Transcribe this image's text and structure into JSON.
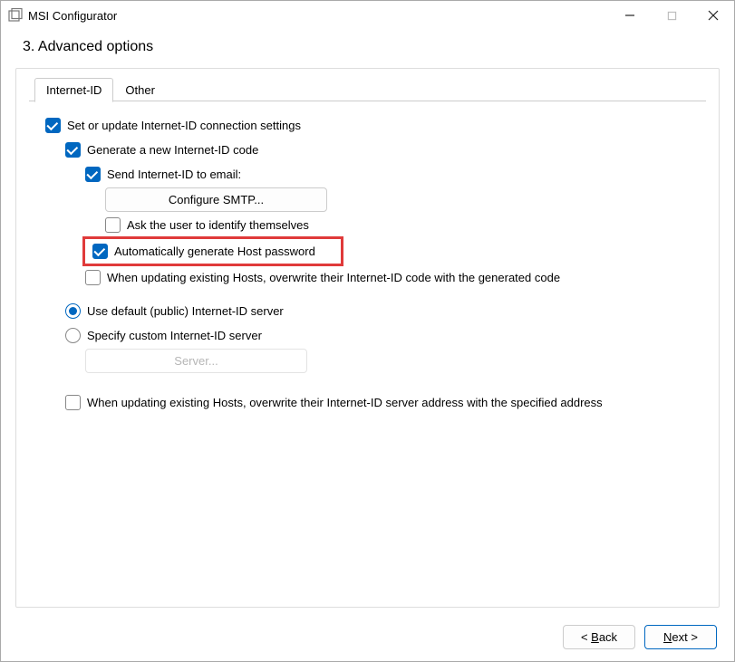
{
  "window": {
    "title": "MSI Configurator"
  },
  "page": {
    "subtitle": "3. Advanced options"
  },
  "tabs": {
    "internet_id": "Internet-ID",
    "other": "Other"
  },
  "form": {
    "set_internet_id": "Set or update Internet-ID connection settings",
    "generate_code": "Generate a new Internet-ID code",
    "send_email": "Send Internet-ID to email:",
    "configure_smtp": "Configure SMTP...",
    "ask_user": "Ask the user to identify themselves",
    "auto_password": "Automatically generate Host password",
    "overwrite_code": "When updating existing Hosts, overwrite their Internet-ID code with the generated code",
    "use_default_server": "Use default (public) Internet-ID server",
    "specify_server": "Specify custom Internet-ID server",
    "server_placeholder": "Server...",
    "overwrite_server": "When updating existing Hosts, overwrite their Internet-ID server address with the specified address"
  },
  "footer": {
    "back_pre": "< ",
    "back_u": "B",
    "back_post": "ack",
    "next_u": "N",
    "next_post": "ext >"
  }
}
